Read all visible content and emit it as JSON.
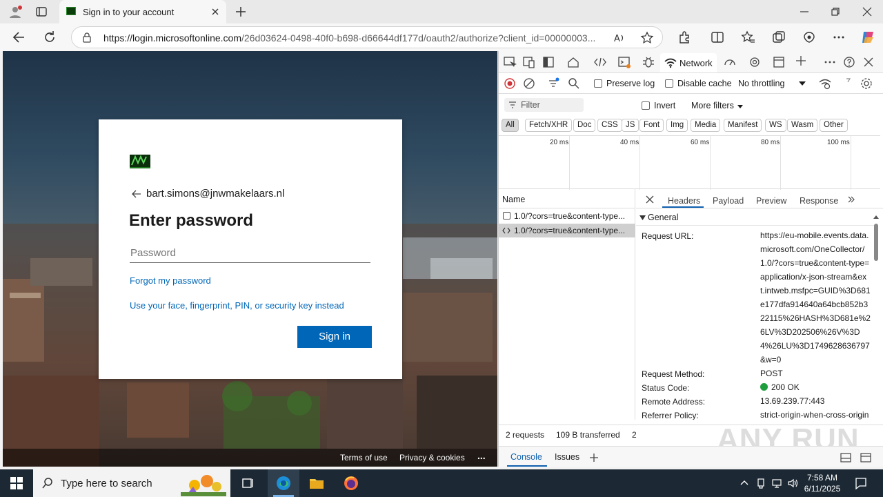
{
  "browser": {
    "tab_title": "Sign in to your account",
    "url_host": "https://login.microsoftonline.com",
    "url_path": "/26d03624-0498-40f0-b698-d66644df177d/oauth2/authorize?client_id=00000003..."
  },
  "login": {
    "email": "bart.simons@jnwmakelaars.nl",
    "heading": "Enter password",
    "password_placeholder": "Password",
    "forgot_link": "Forgot my password",
    "alt_link": "Use your face, fingerprint, PIN, or security key instead",
    "signin_label": "Sign in",
    "footer_terms": "Terms of use",
    "footer_privacy": "Privacy & cookies",
    "footer_more": "..."
  },
  "devtools": {
    "active_tab": "Network",
    "toolbar": {
      "preserve_log": "Preserve log",
      "disable_cache": "Disable cache",
      "throttling": "No throttling"
    },
    "filter": {
      "placeholder": "Filter",
      "invert": "Invert",
      "more_filters": "More filters"
    },
    "types": [
      "All",
      "Fetch/XHR",
      "Doc",
      "CSS",
      "JS",
      "Font",
      "Img",
      "Media",
      "Manifest",
      "WS",
      "Wasm",
      "Other"
    ],
    "timeline_ticks": [
      "20 ms",
      "40 ms",
      "60 ms",
      "80 ms",
      "100 ms"
    ],
    "name_header": "Name",
    "requests": [
      "1.0/?cors=true&content-type...",
      "1.0/?cors=true&content-type..."
    ],
    "detail_tabs": [
      "Headers",
      "Payload",
      "Preview",
      "Response"
    ],
    "general_label": "General",
    "general": {
      "request_url_label": "Request URL:",
      "request_url": "https://eu-mobile.events.data.microsoft.com/OneCollector/1.0/?cors=true&content-type=application/x-json-stream&ext.intweb.msfpc=GUID%3D681e177dfa914640a64bcb852b322115%26HASH%3D681e%26LV%3D202506%26V%3D4%26LU%3D1749628636797&w=0",
      "method_label": "Request Method:",
      "method": "POST",
      "status_label": "Status Code:",
      "status": "200 OK",
      "remote_label": "Remote Address:",
      "remote": "13.69.239.77:443",
      "referrer_label": "Referrer Policy:",
      "referrer": "strict-origin-when-cross-origin"
    },
    "status": {
      "requests": "2 requests",
      "transferred": "109 B transferred",
      "extra": "2"
    },
    "drawer": {
      "console": "Console",
      "issues": "Issues"
    },
    "status_color": "#1f9e3e"
  },
  "taskbar": {
    "search_placeholder": "Type here to search",
    "time": "7:58 AM",
    "date": "6/11/2025"
  },
  "watermark": "ANY RUN"
}
